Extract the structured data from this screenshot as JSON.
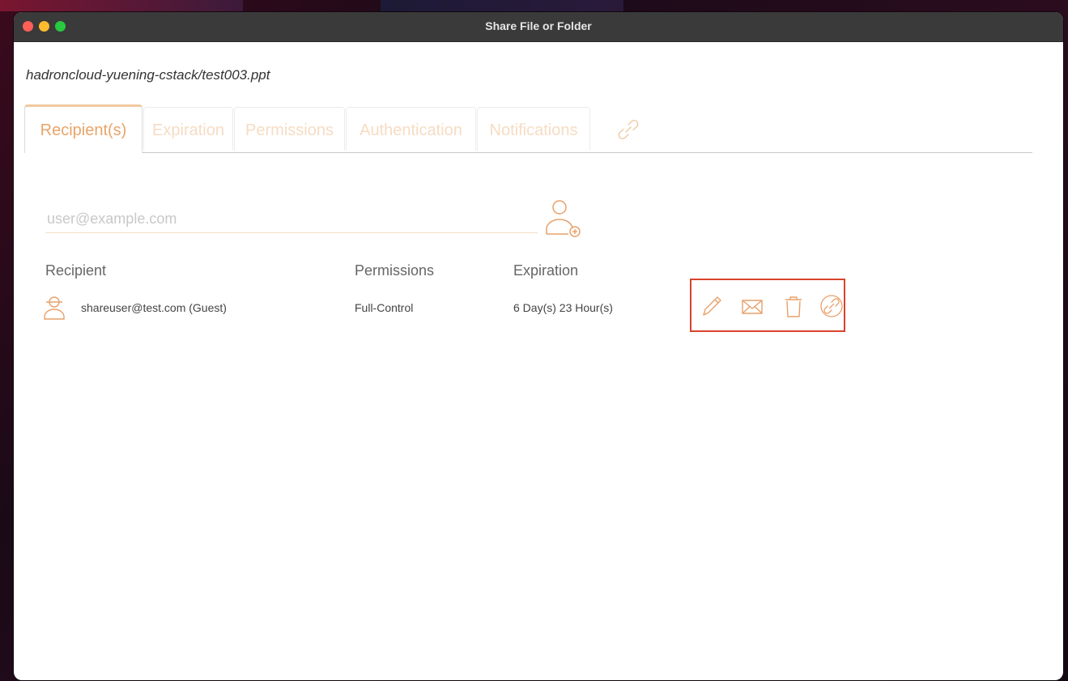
{
  "window": {
    "title": "Share File or Folder"
  },
  "file_path": "hadroncloud-yuening-cstack/test003.ppt",
  "tabs": [
    {
      "label": "Recipient(s)",
      "active": true
    },
    {
      "label": "Expiration",
      "active": false
    },
    {
      "label": "Permissions",
      "active": false
    },
    {
      "label": "Authentication",
      "active": false
    },
    {
      "label": "Notifications",
      "active": false
    }
  ],
  "tab_link_icon": "link-icon",
  "recipient_input": {
    "placeholder": "user@example.com",
    "value": ""
  },
  "add_recipient_icon": "add-user-icon",
  "table": {
    "headers": [
      "Recipient",
      "Permissions",
      "Expiration"
    ],
    "rows": [
      {
        "icon": "guest-user-icon",
        "recipient": "shareuser@test.com (Guest)",
        "permissions": "Full-Control",
        "expiration": "6 Day(s) 23 Hour(s)",
        "actions": [
          "edit-icon",
          "email-icon",
          "delete-icon",
          "link-icon"
        ]
      }
    ]
  },
  "colors": {
    "accent": "#e8a56a",
    "icon": "#e9a06a",
    "tab_inactive_text": "#f6dcc4",
    "highlight_border": "#d9432b",
    "titlebar": "#3b3a3a"
  }
}
